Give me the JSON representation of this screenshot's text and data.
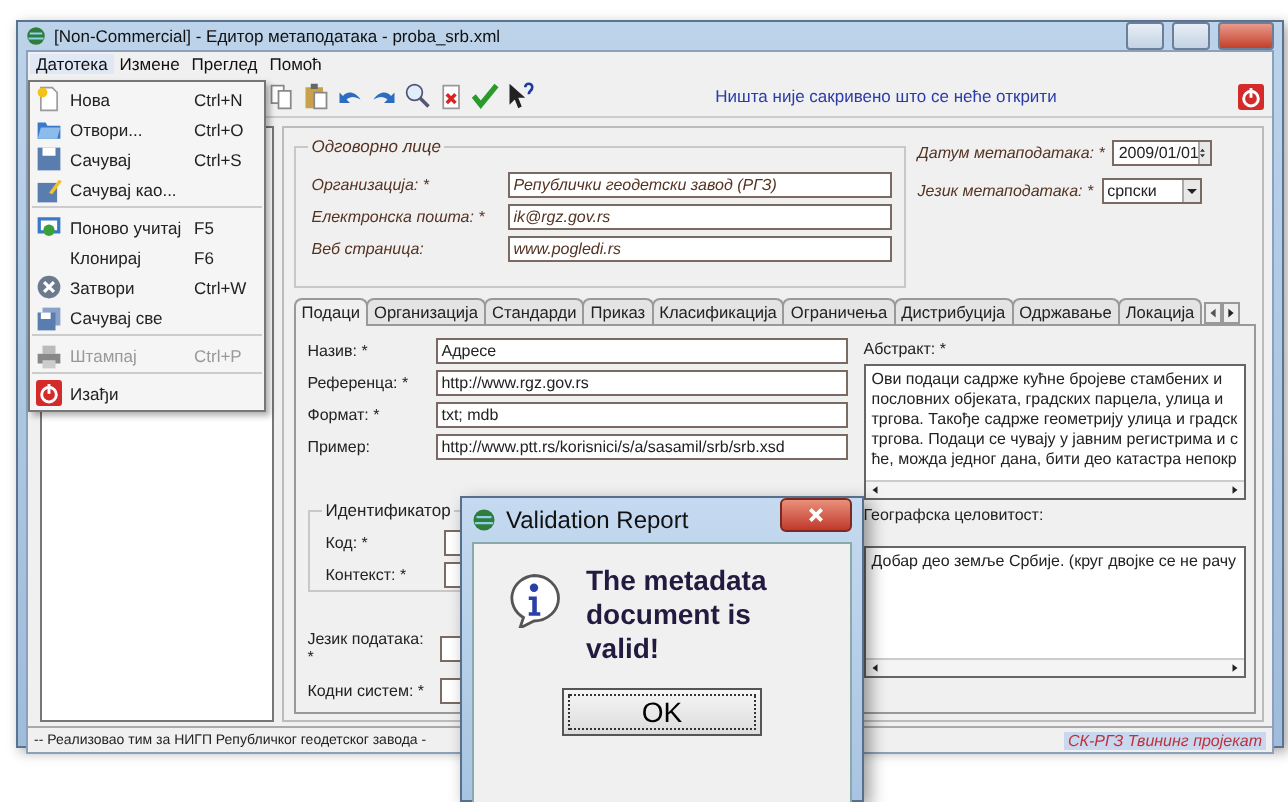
{
  "window": {
    "title": "[Non-Commercial] - Едитор метаподатака - proba_srb.xml"
  },
  "menu_bar": [
    {
      "label": "Датотека",
      "selected": true
    },
    {
      "label": "Измене",
      "selected": false
    },
    {
      "label": "Преглед",
      "selected": false
    },
    {
      "label": "Помоћ",
      "selected": false
    }
  ],
  "file_menu": [
    {
      "label": "Нова",
      "shortcut": "Ctrl+N",
      "disabled": false,
      "separator_after": false
    },
    {
      "label": "Отвори...",
      "shortcut": "Ctrl+O",
      "disabled": false,
      "separator_after": false
    },
    {
      "label": "Сачувај",
      "shortcut": "Ctrl+S",
      "disabled": false,
      "separator_after": false
    },
    {
      "label": "Сачувај као...",
      "disabled": false,
      "separator_after": true
    },
    {
      "label": "Поново учитај",
      "shortcut": "F5",
      "disabled": false,
      "separator_after": false
    },
    {
      "label": "Клонирај",
      "shortcut": "F6",
      "disabled": false,
      "separator_after": false
    },
    {
      "label": "Затвори",
      "shortcut": "Ctrl+W",
      "disabled": false,
      "separator_after": false
    },
    {
      "label": "Сачувај све",
      "disabled": false,
      "separator_after": true
    },
    {
      "label": "Штампај",
      "shortcut": "Ctrl+P",
      "disabled": true,
      "separator_after": true
    },
    {
      "label": "Изађи",
      "disabled": false,
      "separator_after": false
    }
  ],
  "toolbar": {
    "message": "Ништа није сакривено што се неће открити"
  },
  "responsible_party": {
    "title": "Одговорно лице",
    "fields": [
      {
        "label": "Организација: *",
        "value": "Републички геодетски завод (РГЗ)"
      },
      {
        "label": "Електронска пошта: *",
        "value": "ik@rgz.gov.rs"
      },
      {
        "label": "Веб страница:",
        "value": "www.pogledi.rs"
      }
    ]
  },
  "metadata_date": {
    "label": "Датум метаподатака: *",
    "value": "2009/01/01"
  },
  "metadata_language": {
    "label": "Језик метаподатака: *",
    "value": "српски"
  },
  "tabs": [
    {
      "label": "Подаци",
      "selected": true
    },
    {
      "label": "Организација",
      "selected": false
    },
    {
      "label": "Стандарди",
      "selected": false
    },
    {
      "label": "Приказ",
      "selected": false
    },
    {
      "label": "Класификација",
      "selected": false
    },
    {
      "label": "Ограничења",
      "selected": false
    },
    {
      "label": "Дистрибуција",
      "selected": false
    },
    {
      "label": "Одржавање",
      "selected": false
    },
    {
      "label": "Локација",
      "selected": false
    }
  ],
  "data_fields": [
    {
      "label": "Назив: *",
      "value": "Адресе"
    },
    {
      "label": "Референца: *",
      "value": "http://www.rgz.gov.rs"
    },
    {
      "label": "Формат: *",
      "value": "txt; mdb"
    },
    {
      "label": "Пример:",
      "value": "http://www.ptt.rs/korisnici/s/a/sasamil/srb/srb.xsd"
    }
  ],
  "identifier": {
    "title": "Идентификатор",
    "fields": [
      {
        "label": "Код: *"
      },
      {
        "label": "Контекст: *"
      }
    ]
  },
  "lower_fields": [
    {
      "label": "Језик података: *"
    },
    {
      "label": "Кодни систем: *"
    }
  ],
  "abstract": {
    "label": "Абстракт: *",
    "lines": [
      "Ови подаци садрже кућне бројеве стамбених и",
      "пословних објеката, градских парцела, улица и",
      "тргова. Такође садрже геометрију улица и градск",
      "тргова. Подаци се чувају у јавним регистрима и с",
      "ће, можда једног дана, бити део катастра непокр"
    ]
  },
  "geographic_extent": {
    "label": "Географска целовитост:",
    "lines": [
      "Добар део земље Србије. (круг двојке се не рачу"
    ]
  },
  "status_bar": {
    "left": "-- Реализовао тим за НИГП Републичког геодетског завода -",
    "right": "СК-РГЗ Твининг пројекат"
  },
  "dialog": {
    "title": "Validation Report",
    "message": "The metadata document is valid!",
    "button": "OK"
  }
}
